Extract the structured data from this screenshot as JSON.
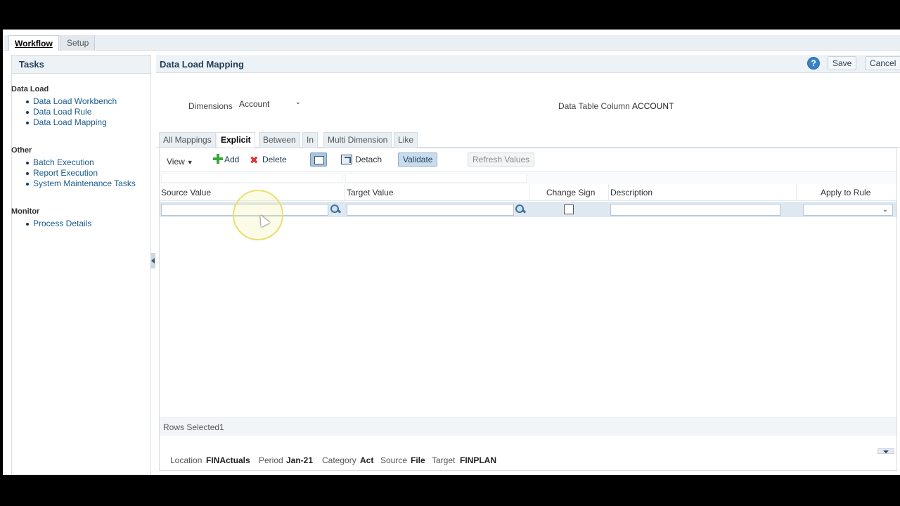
{
  "topbar": {
    "workflow_tab": "Workflow",
    "setup_tab": "Setup"
  },
  "tasks": {
    "title": "Tasks",
    "groups": [
      {
        "label": "Data Load",
        "items": [
          "Data Load Workbench",
          "Data Load Rule",
          "Data Load Mapping"
        ]
      },
      {
        "label": "Other",
        "items": [
          "Batch Execution",
          "Report Execution",
          "System Maintenance Tasks"
        ]
      },
      {
        "label": "Monitor",
        "items": [
          "Process Details"
        ]
      }
    ]
  },
  "main": {
    "title": "Data Load Mapping",
    "help_label": "?",
    "save_label": "Save",
    "cancel_label": "Cancel",
    "dimensions_label": "Dimensions",
    "dimensions_value": "Account",
    "data_table_column_label": "Data Table Column",
    "data_table_column_value": "ACCOUNT",
    "tabs": [
      "All Mappings",
      "Explicit",
      "Between",
      "In",
      "Multi Dimension",
      "Like"
    ],
    "active_tab": "Explicit"
  },
  "toolbar": {
    "view_label": "View",
    "add_label": "Add",
    "delete_label": "Delete",
    "detach_label": "Detach",
    "validate_label": "Validate",
    "refresh_label": "Refresh Values"
  },
  "grid": {
    "columns": [
      "Source Value",
      "Target Value",
      "Change Sign",
      "Description",
      "Apply to Rule"
    ],
    "rows_selected_label": "Rows Selected",
    "rows_selected_count": "1"
  },
  "status": {
    "location_label": "Location",
    "location_value": "FINActuals",
    "period_label": "Period",
    "period_value": "Jan-21",
    "category_label": "Category",
    "category_value": "Act",
    "source_label": "Source",
    "source_value": "File",
    "target_label": "Target",
    "target_value": "FINPLAN"
  }
}
